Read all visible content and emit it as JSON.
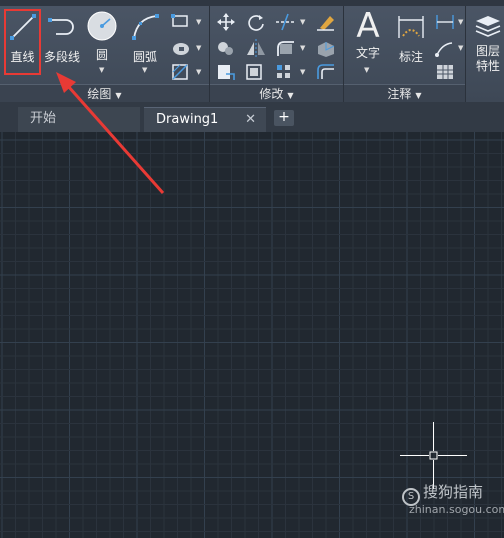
{
  "ribbon": {
    "draw_panel": {
      "title": "绘图",
      "line_label": "直线",
      "polyline_label": "多段线",
      "circle_label": "圆",
      "arc_label": "圆弧"
    },
    "modify_panel": {
      "title": "修改"
    },
    "annotation_panel": {
      "title": "注释",
      "text_label": "文字",
      "dimension_label": "标注"
    },
    "layers_panel": {
      "label_line1": "图层",
      "label_line2": "特性"
    }
  },
  "tabs": [
    {
      "label": "开始"
    },
    {
      "label": "Drawing1",
      "close": "✕"
    }
  ],
  "new_tab_label": "+",
  "watermark": {
    "logo": "S",
    "text": "搜狗指南",
    "url": "zhinan.sogou.com"
  },
  "colors": {
    "canvas_bg": "#212830",
    "grid_minor": "#2b333d",
    "grid_major": "#33404e",
    "highlight": "#e83a35",
    "ribbon_bg": "#45505e"
  }
}
